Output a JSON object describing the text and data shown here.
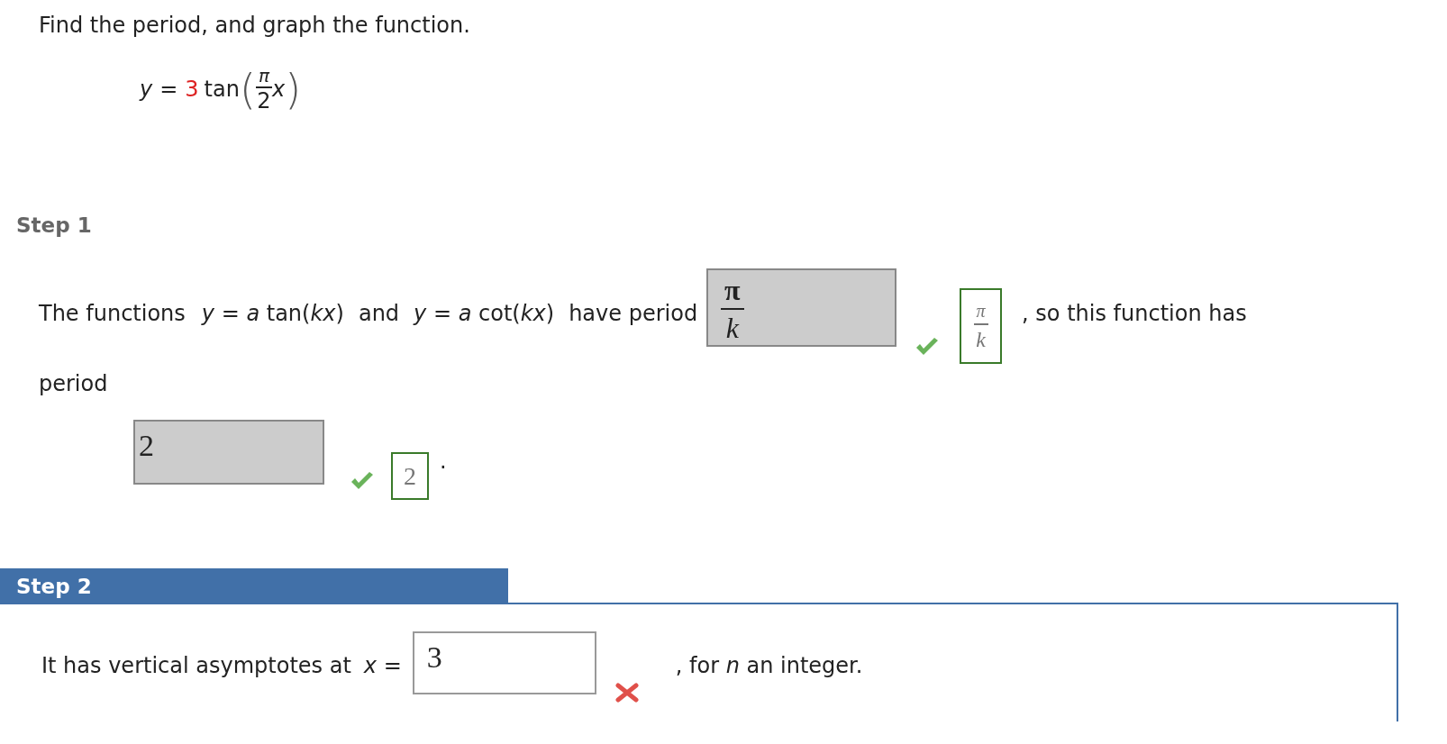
{
  "prompt": "Find the period, and graph the function.",
  "equation": {
    "lhs": "y",
    "equals": "=",
    "coefficient": "3",
    "func": "tan",
    "open_paren": "(",
    "close_paren": ")",
    "numerator": "π",
    "denominator": "2",
    "variable": "x"
  },
  "step1": {
    "title": "Step 1",
    "active": false,
    "sentence_start": "The functions",
    "math_a": "*y* = *a* tan(*kx*)",
    "and": "and",
    "math_b": "*y* = *a* cot(*kx*)",
    "have_period": "have period",
    "answer1": {
      "numerator": "π",
      "denominator": "k",
      "disabled": true,
      "correct": true,
      "solution_numerator": "π",
      "solution_denominator": "k"
    },
    "after": ", so this function has",
    "period_label": "period",
    "answer2": {
      "value": "2",
      "disabled": true,
      "correct": true,
      "solution": "2"
    },
    "end": "."
  },
  "step2": {
    "title": "Step 2",
    "active": true,
    "sentence_start": "It has vertical asymptotes at",
    "math": "*x* =",
    "answer": {
      "value": "3",
      "disabled": false,
      "correct": false
    },
    "after": ", for *n* an integer."
  }
}
